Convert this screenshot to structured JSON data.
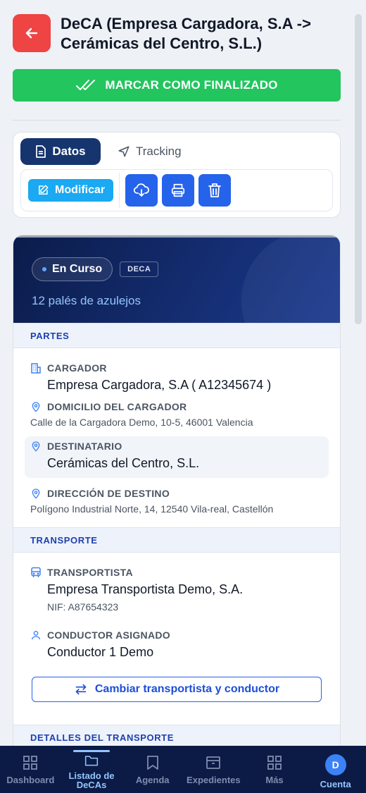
{
  "header": {
    "title": "DeCA (Empresa Cargadora, S.A -> Cerámicas del Centro, S.L.)"
  },
  "actions": {
    "finish_label": "MARCAR COMO FINALIZADO",
    "modify_label": "Modificar"
  },
  "tabs": [
    {
      "label": "Datos"
    },
    {
      "label": "Tracking"
    }
  ],
  "hero": {
    "status": "En Curso",
    "type_badge": "DECA",
    "subtitle": "12 palés de azulejos"
  },
  "sections": {
    "partes": {
      "title": "PARTES",
      "cargador_label": "CARGADOR",
      "cargador_value": "Empresa Cargadora, S.A ( A12345674 )",
      "domicilio_label": "DOMICILIO DEL CARGADOR",
      "domicilio_value": "Calle de la Cargadora Demo, 10-5, 46001 Valencia",
      "destinatario_label": "DESTINATARIO",
      "destinatario_value": "Cerámicas del Centro, S.L.",
      "direccion_label": "DIRECCIÓN DE DESTINO",
      "direccion_value": "Polígono Industrial Norte, 14, 12540 Vila-real, Castellón"
    },
    "transporte": {
      "title": "TRANSPORTE",
      "transportista_label": "TRANSPORTISTA",
      "transportista_value": "Empresa Transportista Demo, S.A.",
      "nif": "NIF: A87654323",
      "conductor_label": "CONDUCTOR ASIGNADO",
      "conductor_value": "Conductor 1 Demo",
      "change_label": "Cambiar transportista y conductor"
    },
    "detalles": {
      "title": "DETALLES DEL TRANSPORTE"
    }
  },
  "nav": [
    {
      "label": "Dashboard",
      "icon": "grid-icon"
    },
    {
      "label": "Listado de DeCAs",
      "icon": "folder-icon"
    },
    {
      "label": "Agenda",
      "icon": "bookmark-icon"
    },
    {
      "label": "Expedientes",
      "icon": "archive-icon"
    },
    {
      "label": "Más",
      "icon": "grid-icon"
    },
    {
      "label": "Cuenta",
      "icon": "avatar"
    }
  ],
  "avatar_initial": "D",
  "colors": {
    "accent": "#2563eb",
    "navy": "#0c1b45",
    "success": "#22c55e",
    "danger": "#ef4444"
  }
}
